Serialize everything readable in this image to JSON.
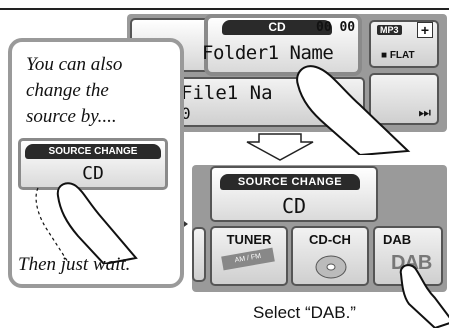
{
  "top_display": {
    "source_badge": "CD",
    "track_time": "00 00",
    "folder_name": "Folder1 Name",
    "file_name": "File1 Na",
    "file_number": "0",
    "mp3_badge": "MP3",
    "plus_symbol": "+",
    "eq_label": "FLAT",
    "skip_symbol": "⏭"
  },
  "callout": {
    "text_line1": "You can also",
    "text_line2": "change the",
    "text_line3": "source by....",
    "source_change_label": "SOURCE CHANGE",
    "source_value": "CD",
    "wait_text": "Then just wait."
  },
  "source_change_screen": {
    "source_change_label": "SOURCE CHANGE",
    "source_value": "CD",
    "options": [
      {
        "label": "TUNER",
        "sub": "AM / FM"
      },
      {
        "label": "CD-CH",
        "sub": ""
      },
      {
        "label": "DAB",
        "sub": "DAB"
      }
    ]
  },
  "instruction": {
    "caption": "Select “DAB.”"
  },
  "colors": {
    "panel_gray": "#9a9a9a",
    "dark_badge": "#2a2a2a",
    "button_light": "#ececec",
    "outline": "#555555"
  }
}
